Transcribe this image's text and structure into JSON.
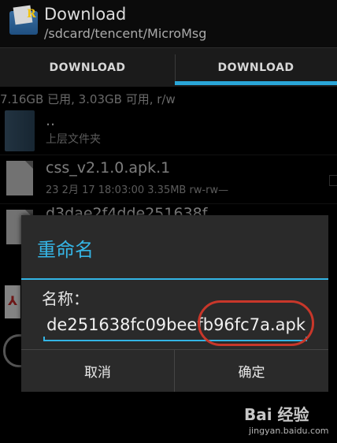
{
  "header": {
    "title": "Download",
    "path": "/sdcard/tencent/MicroMsg"
  },
  "tabs": [
    {
      "label": "DOWNLOAD"
    },
    {
      "label": "DOWNLOAD"
    }
  ],
  "storage": "7.16GB 已用, 3.03GB 可用, r/w",
  "list": [
    {
      "name": "..",
      "meta": "上层文件夹",
      "icon": "folder-icon"
    },
    {
      "name": "css_v2.1.0.apk.1",
      "meta": "23 2月 17 18:03:00  3.35MB  rw-rw—",
      "icon": "file-icon"
    },
    {
      "name": "d3dae2f4dde251638f",
      "icon": "file-icon"
    }
  ],
  "dialog": {
    "title": "重命名",
    "label": "名称：",
    "input_value": "de251638fc09beefb96fc7a.apk",
    "cancel": "取消",
    "ok": "确定"
  },
  "watermark": {
    "brand": "Bai 经验",
    "url": "jingyan.baidu.com"
  },
  "colors": {
    "accent": "#33b5e5",
    "highlight": "#c8372a"
  }
}
